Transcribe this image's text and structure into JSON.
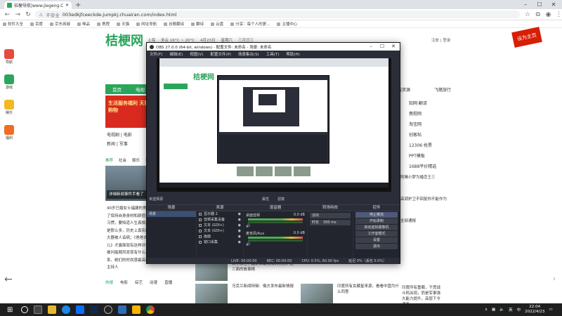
{
  "browser": {
    "tab_title": "桔梗导航|www.jiegeng.Com|桔...",
    "url": "003edkjfceeckde.jumpkj.chuairan.com/index.html",
    "security": "不安全",
    "bookmarks": [
      "软件大全",
      "百度",
      "京东商城",
      "唯品",
      "携程",
      "天猫",
      "网址导航",
      "谷歌翻译",
      "翻译",
      "云盘",
      "分享：每个人的更...",
      "主播中心"
    ]
  },
  "page": {
    "logo": "桔梗网",
    "top_info": [
      "上海",
      "多云 16°C ~ 20°C",
      "4月23日",
      "星期六",
      "三月廿三"
    ],
    "top_links": "注册 | 登录",
    "promo": "设为主页",
    "rail": [
      "导航",
      "游戏",
      "娱乐",
      "福利"
    ],
    "nav_home": "首页",
    "nav_2": "电视",
    "banner_text": "生活服务福利 天猫购物",
    "left_links": [
      "电视剧 | 电影",
      "新闻 | 军事"
    ],
    "categories": [
      "推荐",
      "社会",
      "娱乐",
      "科技"
    ],
    "left_img_caption": "详细新闻事件手看了",
    "article": "40岁已婚女士福建的男子为了保持自身身材和颜值养成习惯，要知道人生真相并不是那么多，历史上真实的赵大器被人诟病；《爸爸去哪儿》才露面就有这样评价，被问能顺风发现有什么关系、她们的时尚感最高级的主持人",
    "bottom_cats": [
      "热搜",
      "电影",
      "综艺",
      "动漫",
      "直播"
    ],
    "right_nav": [
      "游戏资源",
      "飞猪旅行"
    ],
    "right_links": [
      "知网·翻译",
      "携程网",
      "淘宝网",
      "创客帖",
      "12306·抢票",
      "PPT模板",
      "1688平价精选"
    ],
    "right_snips": [
      "阿琳小梦为婚恋王三",
      "高调护卫不回复你不能作为",
      "全部通报"
    ],
    "bottom_news": [
      "关于那些中国史上最无情的男孩，这三面的故事精",
      "乌克兰新闻特辑：俄方发布最新情报",
      "印度所有女藏星来源，看看中国为什么同意"
    ],
    "right_news": "印度所有重载，干恶战斗机出现，而是军事强大能力提升，高层下令调查"
  },
  "obs": {
    "title": "OBS 27.0.0 (64-bit, windows) - 配置文件: 未命名 - 场景: 未命名",
    "menu": [
      "文件(F)",
      "编辑(E)",
      "视图(V)",
      "配置文件(P)",
      "场景集合(S)",
      "工具(T)",
      "帮助(H)"
    ],
    "preview_label": "未选择源",
    "preview_tabs": [
      "属性",
      "滤镜"
    ],
    "docks": {
      "scenes": {
        "title": "场景",
        "items": [
          "场景"
        ]
      },
      "sources": {
        "title": "来源",
        "items": [
          "显示器 2",
          "音频采集设备",
          "文本 (GDI+)",
          "文本 (GDI+)",
          "画面",
          "窗口采集"
        ]
      },
      "mixer": {
        "title": "混音器",
        "rows": [
          {
            "name": "桌面音频",
            "db": "0.0 dB"
          },
          {
            "name": "麦克风/Aux",
            "db": "0.0 dB"
          }
        ]
      },
      "transitions": {
        "title": "转场特效",
        "type": "淡出",
        "duration_label": "时长",
        "duration": "300 ms"
      },
      "controls": {
        "title": "控件",
        "buttons": [
          "停止推流",
          "开始录制",
          "启动虚拟摄像机",
          "工作室模式",
          "设置",
          "退出"
        ]
      }
    },
    "status": [
      "LIVE: 00:00:00",
      "REC: 00:00:00",
      "CPU: 0.5%, 60.00 fps",
      "延迟 0%（丢包 0.0%）"
    ]
  },
  "taskbar": {
    "time": "22:04",
    "date": "2022/4/23",
    "ime": "英",
    "lang": "中"
  }
}
